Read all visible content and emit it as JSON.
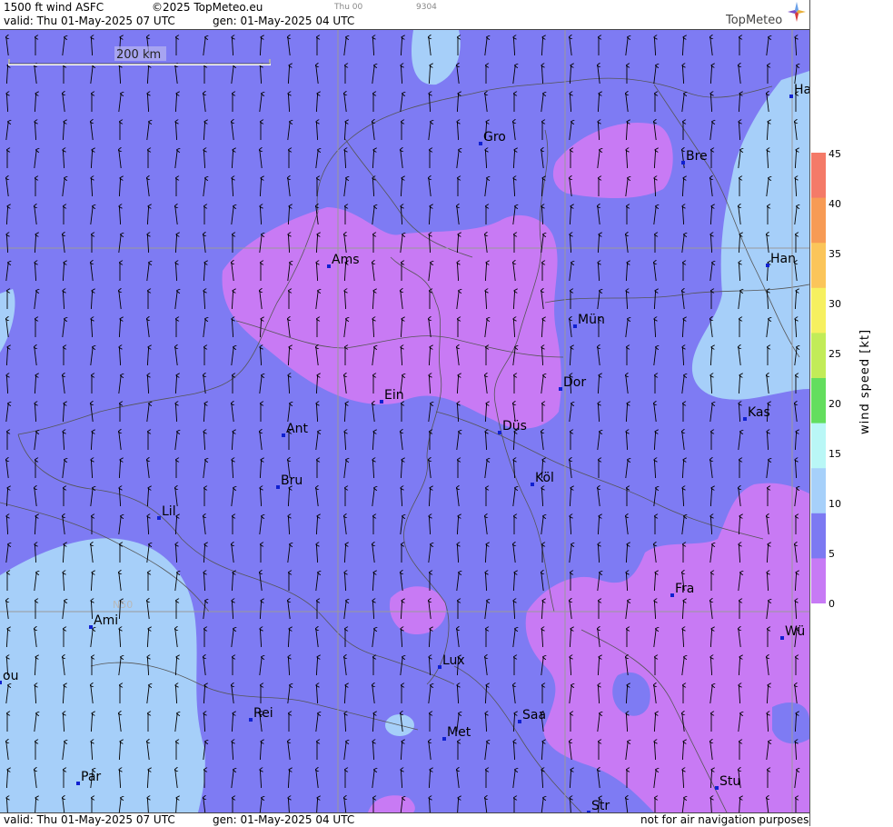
{
  "header": {
    "product": "1500 ft wind ASFC",
    "copyright": "©2025 TopMeteo.eu",
    "step_time": "Thu 00",
    "code": "9304",
    "valid": "valid:  Thu  01-May-2025  07 UTC",
    "generated": "gen: 01-May-2025 04 UTC",
    "brand": "TopMeteo"
  },
  "footer": {
    "valid": "valid:  Thu  01-May-2025  07 UTC",
    "generated": "gen: 01-May-2025 04 UTC",
    "disclaimer": "not for air navigation purposes"
  },
  "map": {
    "scale_label": "200 km",
    "latitude_label": "N50",
    "cities": [
      {
        "name": "Ha"
      },
      {
        "name": "Gro"
      },
      {
        "name": "Bre"
      },
      {
        "name": "Ams"
      },
      {
        "name": "Han"
      },
      {
        "name": "Mün"
      },
      {
        "name": "Ein"
      },
      {
        "name": "Dor"
      },
      {
        "name": "Kas"
      },
      {
        "name": "Ant"
      },
      {
        "name": "Düs"
      },
      {
        "name": "Bru"
      },
      {
        "name": "Köl"
      },
      {
        "name": "Lil"
      },
      {
        "name": "Fra"
      },
      {
        "name": "Ami"
      },
      {
        "name": "Wü"
      },
      {
        "name": "ou"
      },
      {
        "name": "Lux"
      },
      {
        "name": "Rei"
      },
      {
        "name": "Saa"
      },
      {
        "name": "Met"
      },
      {
        "name": "Par"
      },
      {
        "name": "Stu"
      },
      {
        "name": "Str"
      }
    ]
  },
  "legend": {
    "title": "wind speed [kt]",
    "ticks": [
      "45",
      "40",
      "35",
      "30",
      "25",
      "20",
      "15",
      "10",
      "5",
      "0"
    ],
    "colors": [
      "#f47a68",
      "#f79b55",
      "#fbc55a",
      "#f6f060",
      "#c2ec58",
      "#63de5e",
      "#b9f7f6",
      "#a6d0fa",
      "#7c79f2",
      "#c77af5"
    ]
  }
}
